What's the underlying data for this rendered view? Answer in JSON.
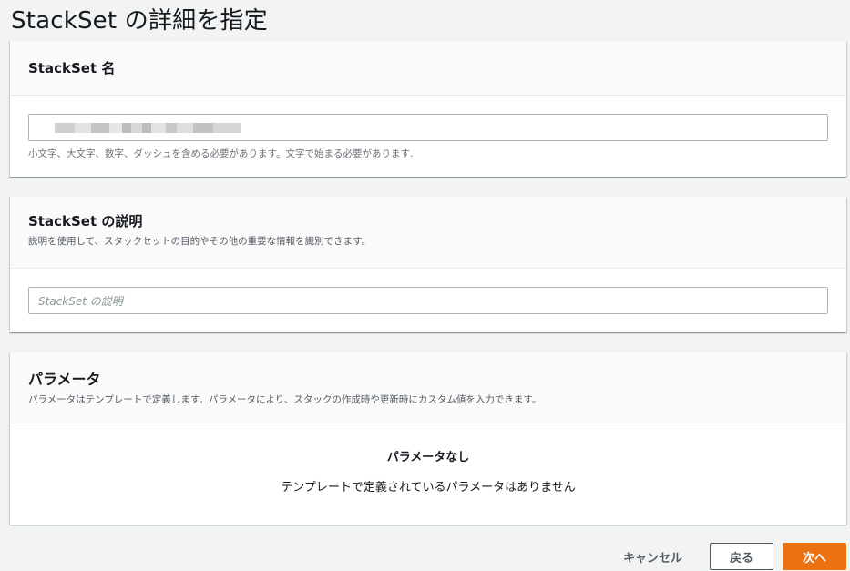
{
  "page": {
    "title": "StackSet の詳細を指定"
  },
  "name_panel": {
    "title": "StackSet 名",
    "input_value_redacted": true,
    "hint": "小文字、大文字、数字、ダッシュを含める必要があります。文字で始まる必要があります."
  },
  "description_panel": {
    "title": "StackSet の説明",
    "description": "説明を使用して、スタックセットの目的やその他の重要な情報を識別できます。",
    "input_placeholder": "StackSet の説明"
  },
  "parameters_panel": {
    "title": "パラメータ",
    "description": "パラメータはテンプレートで定義します。パラメータにより、スタックの作成時や更新時にカスタム値を入力できます。",
    "empty_title": "パラメータなし",
    "empty_text": "テンプレートで定義されているパラメータはありません"
  },
  "footer": {
    "cancel_label": "キャンセル",
    "back_label": "戻る",
    "next_label": "次へ"
  },
  "colors": {
    "primary": "#ec7211",
    "background": "#f2f3f3"
  }
}
